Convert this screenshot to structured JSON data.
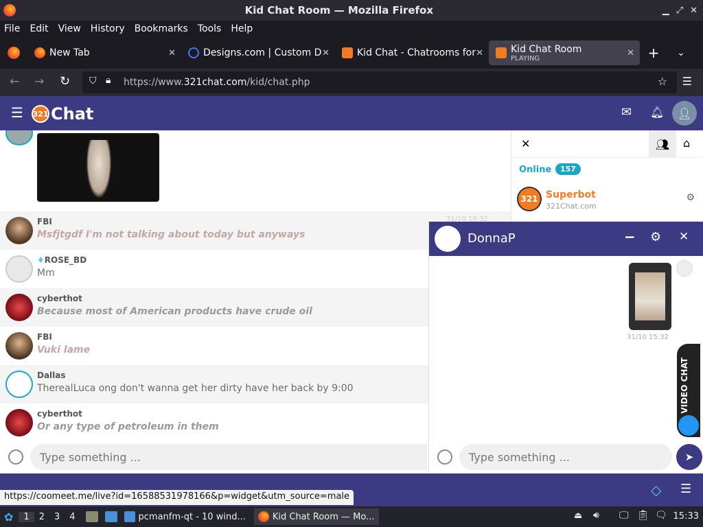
{
  "window": {
    "title": "Kid Chat Room — Mozilla Firefox"
  },
  "menu": [
    "File",
    "Edit",
    "View",
    "History",
    "Bookmarks",
    "Tools",
    "Help"
  ],
  "tabs": [
    {
      "label": "New Tab"
    },
    {
      "label": "Designs.com | Custom D"
    },
    {
      "label": "Kid Chat - Chatrooms for"
    },
    {
      "label": "Kid Chat Room",
      "sub": "PLAYING"
    }
  ],
  "url": {
    "prefix": "https://www.",
    "domain": "321chat.com",
    "path": "/kid/chat.php"
  },
  "site": {
    "logo_num": "321",
    "logo_word": "Chat"
  },
  "messages": [
    {
      "user": "FBI",
      "text": "Msfjtgdf I'm not talking about today but anyways",
      "time": "31/10 15:32"
    },
    {
      "user": "ROSE_BD",
      "text": "Mm"
    },
    {
      "user": "cyberthot",
      "text": "Because most of American products have crude oil"
    },
    {
      "user": "FBI",
      "text": "Vuki lame"
    },
    {
      "user": "Dallas",
      "text": "TherealLuca ong don't wanna get her dirty have her back by 9:00"
    },
    {
      "user": "cyberthot",
      "text": "Or any type of petroleum in them"
    }
  ],
  "sidebar": {
    "online_label": "Online",
    "online_count": "157",
    "bot_name": "Superbot",
    "bot_sub": "321Chat.com",
    "bot_num": "321"
  },
  "pm": {
    "name": "DonnaP",
    "time": "31/10 15:32",
    "video_label": "VIDEO CHAT",
    "placeholder": "Type something ..."
  },
  "main_input": {
    "placeholder": "Type something ..."
  },
  "status_url": "https://coomeet.me/live?id=16588531978166&p=widget&utm_source=male",
  "taskbar": {
    "workspaces": [
      "1",
      "2",
      "3",
      "4"
    ],
    "tasks": [
      "pcmanfm-qt - 10 wind...",
      "Kid Chat Room — Mo..."
    ],
    "clock": "15:33"
  },
  "colors": {
    "brand": "#3b3a82",
    "accent": "#f47b20",
    "online": "#1aa6c8"
  }
}
